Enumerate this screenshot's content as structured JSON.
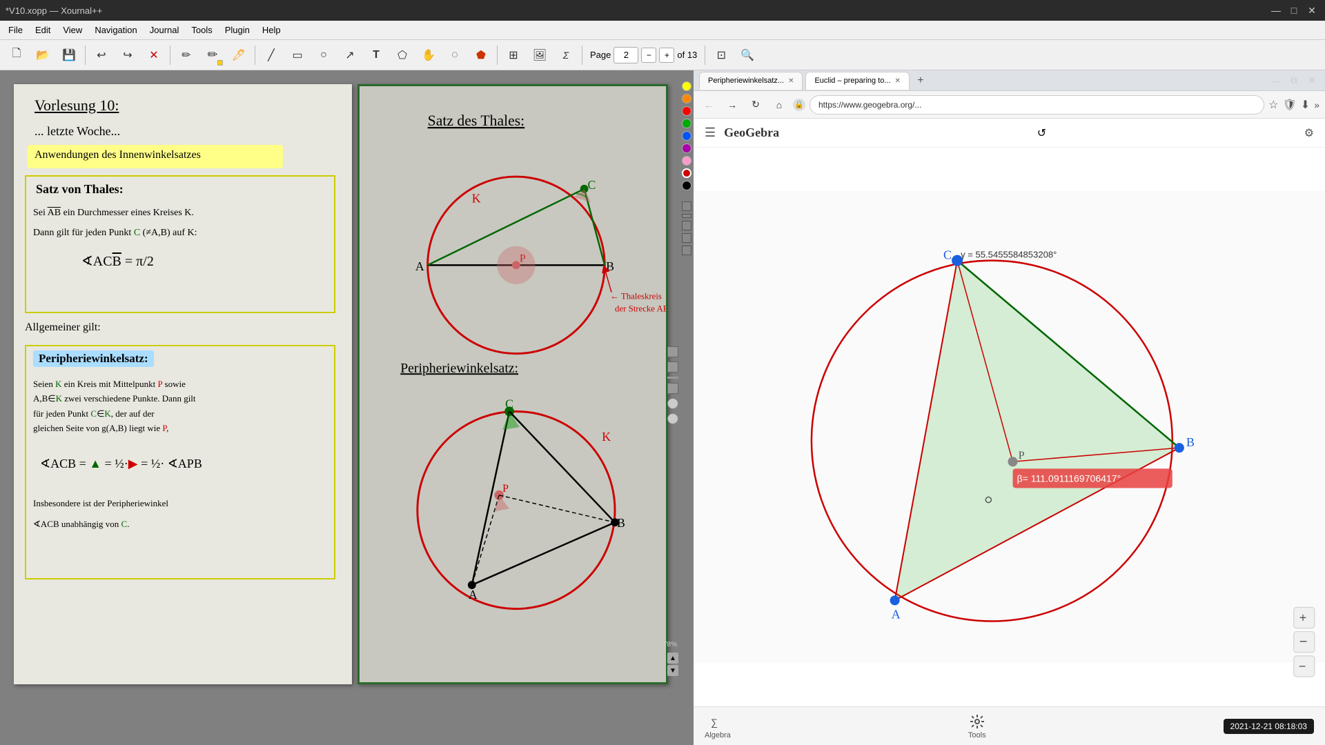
{
  "window": {
    "title": "*V10.xopp — Xournal++",
    "titlebar_controls": [
      "—",
      "□",
      "✕"
    ]
  },
  "menubar": {
    "items": [
      "File",
      "Edit",
      "View",
      "Navigation",
      "Journal",
      "Tools",
      "Plugin",
      "Help"
    ]
  },
  "toolbar": {
    "page_label": "Page",
    "page_number": "2",
    "page_of": "of 13",
    "page_minus": "−",
    "page_plus": "+"
  },
  "colors": {
    "yellow_highlight": "#ffff88",
    "red": "#cc0000",
    "green": "#006600",
    "circle_red": "#cc0000"
  },
  "left_page": {
    "title": "Vorlesung 10:",
    "subtitle": "... letzte Woche...",
    "highlight1": "Anwendungen des Innenwinkelsatzes",
    "box1_title": "Satz von Thales:",
    "box1_line1": "Sei AB ein Durchmesser eines Kreises K.",
    "box1_line2": "Dann gilt für jeden Punkt C (≠A,B) auf K:",
    "box1_formula": "∢ACB = π/2",
    "allgemein": "Allgemeiner gilt:",
    "box2_title": "Peripheriewinkelsatz:",
    "box2_line1": "Seien K ein Kreis mit Mittelpunkt P sowie",
    "box2_line2": "A,B∈K zwei verschiedene Punkte. Dann gilt",
    "box2_line3": "für jeden Punkt C∈K, der auf der",
    "box2_line4": "gleichen Seite von g(A,B) liegt wie P,",
    "box2_formula": "∢ACB = △ = ½·▷ = ½·∢APB",
    "footer1": "Insbesondere ist der Peripheriewinkel",
    "footer2": "∢ACB unabhängig von C."
  },
  "right_page": {
    "title1": "Satz des Thales:",
    "title2": "Peripheriewinkelsatz:",
    "labels_top": [
      "C",
      "K",
      "A",
      "B",
      "P"
    ],
    "labels_bottom": [
      "C",
      "K",
      "A",
      "B",
      "P"
    ],
    "annotation": "Thaleskreis der Strecke AB"
  },
  "browser": {
    "tabs": [
      {
        "label": "Peripheriewinkelsatz...",
        "active": false
      },
      {
        "label": "Euclid – preparing to...",
        "active": true
      }
    ],
    "url": "https://www.geogebra.org/...",
    "app_name": "GeoGebra"
  },
  "geogebra": {
    "angle_gamma_label": "γ = 55.5455584853208°",
    "angle_beta_label": "β= 111.0911169706417°",
    "point_labels": [
      "C",
      "B",
      "P",
      "A"
    ],
    "back_icon": "↺",
    "settings_icon": "⚙",
    "menu_icon": "☰",
    "algebra_label": "Algebra",
    "tools_label": "Tools",
    "datetime": "2021-12-21  08:18:03"
  },
  "palette": {
    "colors": [
      "#ffff00",
      "#ff8800",
      "#ff0000",
      "#00aa00",
      "#0055ff",
      "#aa00aa",
      "#ff99cc",
      "#ff0000",
      "#000000"
    ]
  }
}
